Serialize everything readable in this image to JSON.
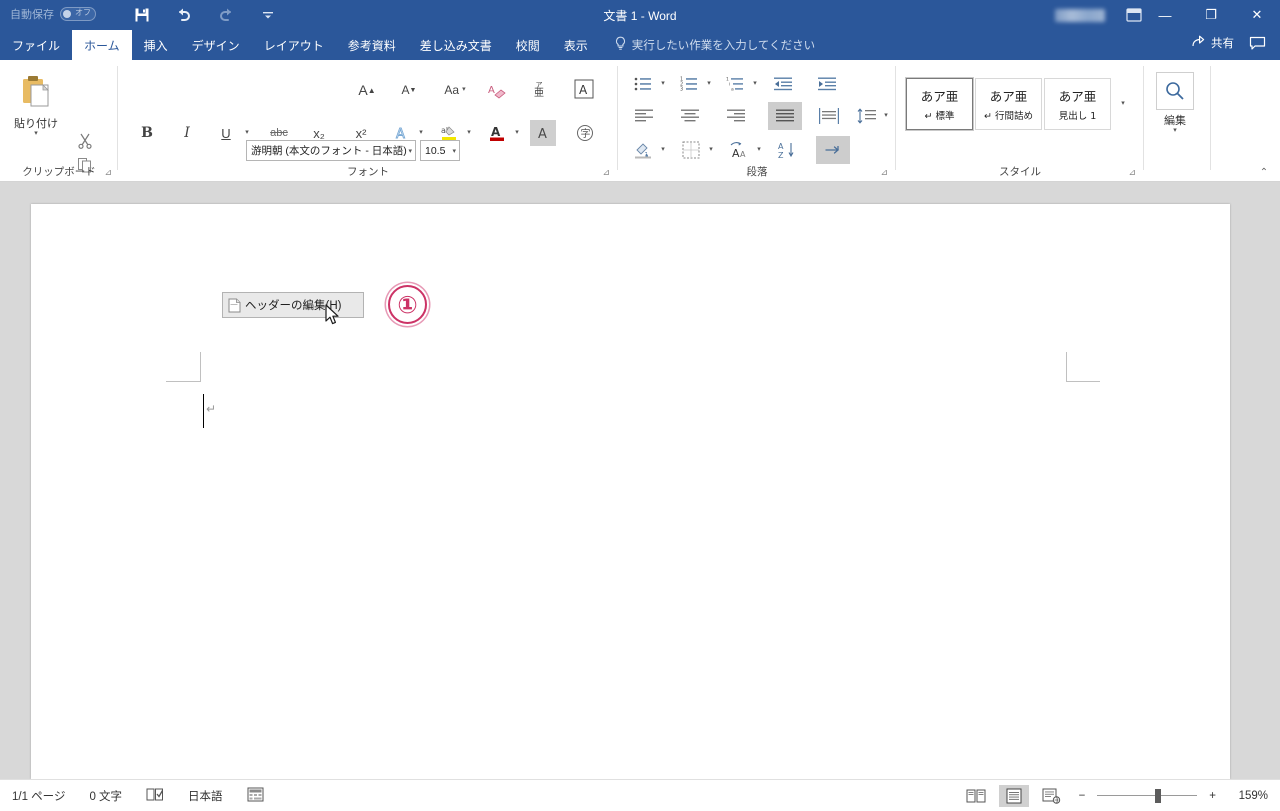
{
  "titlebar": {
    "autosave_label": "自動保存",
    "autosave_state": "オフ",
    "document_title": "文書 1  -  Word",
    "quick_access": [
      {
        "name": "save-icon",
        "glyph": "💾"
      },
      {
        "name": "undo-icon",
        "glyph": "↺"
      },
      {
        "name": "redo-icon",
        "glyph": "↻"
      },
      {
        "name": "customize-qat-icon",
        "glyph": "⌄"
      }
    ],
    "window_controls": {
      "minimize": "―",
      "restore": "❐",
      "close": "✕"
    }
  },
  "tabs": [
    {
      "label": "ファイル",
      "active": false
    },
    {
      "label": "ホーム",
      "active": true
    },
    {
      "label": "挿入",
      "active": false
    },
    {
      "label": "デザイン",
      "active": false
    },
    {
      "label": "レイアウト",
      "active": false
    },
    {
      "label": "参考資料",
      "active": false
    },
    {
      "label": "差し込み文書",
      "active": false
    },
    {
      "label": "校閲",
      "active": false
    },
    {
      "label": "表示",
      "active": false
    }
  ],
  "tellme": {
    "placeholder": "実行したい作業を入力してください",
    "icon": "lightbulb-icon"
  },
  "share": {
    "label": "共有",
    "icon": "share-icon",
    "comment_icon": "comment-icon"
  },
  "ribbon": {
    "clipboard": {
      "group_label": "クリップボード",
      "paste_label": "貼り付け",
      "cut_name": "cut-icon",
      "copy_name": "copy-icon",
      "format_painter_name": "format-painter-icon"
    },
    "font": {
      "group_label": "フォント",
      "font_name": "游明朝 (本文のフォント - 日本語)",
      "font_size": "10.5",
      "grow_font": "A",
      "shrink_font": "A",
      "change_case": "Aa",
      "clear_format": "clear-formatting-icon",
      "phonetic_guide": "ルビ",
      "char_border": "A",
      "bold": "B",
      "italic": "I",
      "underline": "U",
      "strikethrough": "abc",
      "subscript": "x₂",
      "superscript": "x²",
      "text_effects": "A",
      "highlight": "ab",
      "font_color": "A",
      "char_shading": "A",
      "enclose_char": "字"
    },
    "paragraph": {
      "group_label": "段落",
      "bullets": "bullet-list-icon",
      "numbering": "numbered-list-icon",
      "multilevel": "multilevel-list-icon",
      "decrease_indent": "decrease-indent-icon",
      "increase_indent": "increase-indent-icon",
      "align_left": "align-left-icon",
      "align_center": "align-center-icon",
      "align_right": "align-right-icon",
      "justify": "justify-icon",
      "distribute": "distribute-icon",
      "line_spacing": "line-spacing-icon",
      "shading": "shading-icon",
      "borders": "borders-icon",
      "asian_layout": "asian-layout-icon",
      "sort": "sort-icon",
      "show_marks": "show-formatting-marks-icon"
    },
    "styles": {
      "group_label": "スタイル",
      "items": [
        {
          "sample": "あア亜",
          "name": "↵ 標準",
          "selected": true
        },
        {
          "sample": "あア亜",
          "name": "↵ 行間詰め",
          "selected": false
        },
        {
          "sample": "あア亜",
          "name": "見出し 1",
          "selected": false
        }
      ],
      "more_caret": "▾"
    },
    "editing": {
      "group_label": "",
      "label": "編集",
      "icon": "search-icon"
    },
    "collapse_icon": "collapse-ribbon-icon"
  },
  "document": {
    "context_menu": {
      "item_label": "ヘッダーの編集(H)",
      "item_icon": "edit-header-icon"
    },
    "annotation": {
      "marker": "①"
    },
    "paragraph_mark": "↵",
    "cursor_icon": "mouse-pointer-icon"
  },
  "statusbar": {
    "page_count": "1/1 ページ",
    "word_count": "0 文字",
    "proofing_icon": "proofing-icon",
    "language": "日本語",
    "macro_icon": "macro-record-icon",
    "views": [
      {
        "name": "read-mode-view-button",
        "active": false
      },
      {
        "name": "print-layout-view-button",
        "active": true
      },
      {
        "name": "web-layout-view-button",
        "active": false
      }
    ],
    "zoom_out": "−",
    "zoom_in": "+",
    "zoom_level": "159%"
  },
  "colors": {
    "brand": "#2b579a",
    "annotation": "#cc3366",
    "page": "#ffffff",
    "workspace": "#d8d8d8"
  }
}
